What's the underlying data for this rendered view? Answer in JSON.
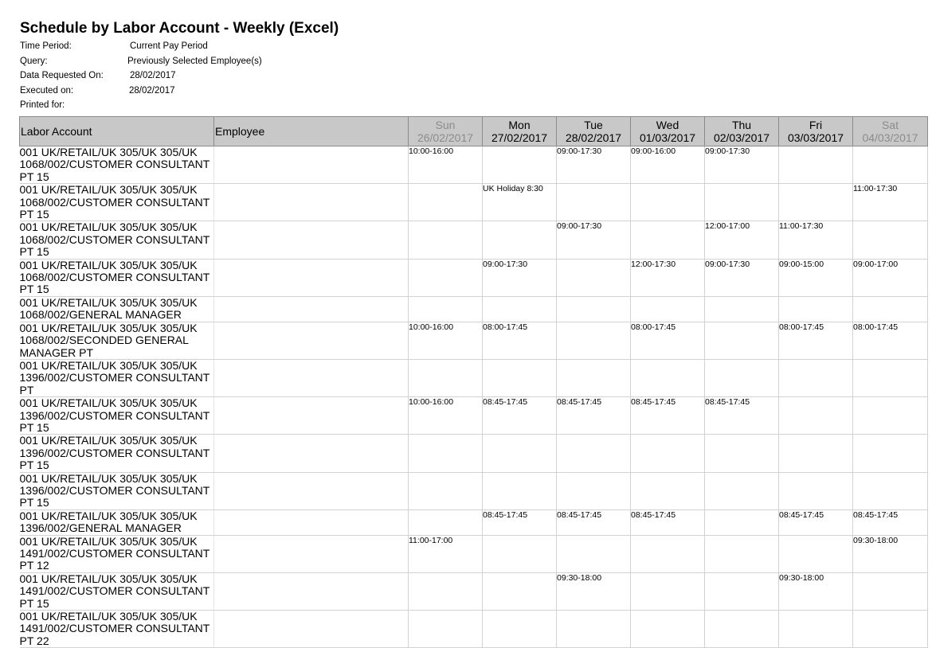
{
  "report": {
    "title": "Schedule by Labor Account - Weekly (Excel)",
    "meta": [
      {
        "label": "Time Period:",
        "value": "Current Pay Period"
      },
      {
        "label": "Query:",
        "value": "Previously Selected Employee(s)"
      },
      {
        "label": "Data Requested On:",
        "value": "28/02/2017"
      },
      {
        "label": "Executed on:",
        "value": "28/02/2017"
      },
      {
        "label": "Printed for:",
        "value": ""
      }
    ]
  },
  "table": {
    "headers": {
      "labor_account": "Labor Account",
      "employee": "Employee"
    },
    "days": [
      {
        "name": "Sun",
        "date": "26/02/2017",
        "weekend": true
      },
      {
        "name": "Mon",
        "date": "27/02/2017",
        "weekend": false
      },
      {
        "name": "Tue",
        "date": "28/02/2017",
        "weekend": false
      },
      {
        "name": "Wed",
        "date": "01/03/2017",
        "weekend": false
      },
      {
        "name": "Thu",
        "date": "02/03/2017",
        "weekend": false
      },
      {
        "name": "Fri",
        "date": "03/03/2017",
        "weekend": false
      },
      {
        "name": "Sat",
        "date": "04/03/2017",
        "weekend": true
      }
    ],
    "rows": [
      {
        "account": "001 UK/RETAIL/UK 305/UK 305/UK 1068/002/CUSTOMER CONSULTANT PT 15",
        "employee": "",
        "shifts": [
          "10:00-16:00",
          "",
          "09:00-17:30",
          "09:00-16:00",
          "09:00-17:30",
          "",
          ""
        ]
      },
      {
        "account": "001 UK/RETAIL/UK 305/UK 305/UK 1068/002/CUSTOMER CONSULTANT PT 15",
        "employee": "",
        "shifts": [
          "",
          "UK Holiday 8:30",
          "",
          "",
          "",
          "",
          "11:00-17:30"
        ]
      },
      {
        "account": "001 UK/RETAIL/UK 305/UK 305/UK 1068/002/CUSTOMER CONSULTANT PT 15",
        "employee": "",
        "shifts": [
          "",
          "",
          "09:00-17:30",
          "",
          "12:00-17:00",
          "11:00-17:30",
          ""
        ]
      },
      {
        "account": "001 UK/RETAIL/UK 305/UK 305/UK 1068/002/CUSTOMER CONSULTANT PT 15",
        "employee": "",
        "shifts": [
          "",
          "09:00-17:30",
          "",
          "12:00-17:30",
          "09:00-17:30",
          "09:00-15:00",
          "09:00-17:00"
        ]
      },
      {
        "account": "001 UK/RETAIL/UK 305/UK 305/UK 1068/002/GENERAL MANAGER",
        "employee": "",
        "shifts": [
          "",
          "",
          "",
          "",
          "",
          "",
          ""
        ]
      },
      {
        "account": "001 UK/RETAIL/UK 305/UK 305/UK 1068/002/SECONDED GENERAL MANAGER PT",
        "employee": "",
        "shifts": [
          "10:00-16:00",
          "08:00-17:45",
          "",
          "08:00-17:45",
          "",
          "08:00-17:45",
          "08:00-17:45"
        ]
      },
      {
        "account": "001 UK/RETAIL/UK 305/UK 305/UK 1396/002/CUSTOMER CONSULTANT PT",
        "employee": "",
        "shifts": [
          "",
          "",
          "",
          "",
          "",
          "",
          ""
        ]
      },
      {
        "account": "001 UK/RETAIL/UK 305/UK 305/UK 1396/002/CUSTOMER CONSULTANT PT 15",
        "employee": "",
        "shifts": [
          "10:00-16:00",
          "08:45-17:45",
          "08:45-17:45",
          "08:45-17:45",
          "08:45-17:45",
          "",
          ""
        ]
      },
      {
        "account": "001 UK/RETAIL/UK 305/UK 305/UK 1396/002/CUSTOMER CONSULTANT PT 15",
        "employee": "",
        "shifts": [
          "",
          "",
          "",
          "",
          "",
          "",
          ""
        ]
      },
      {
        "account": "001 UK/RETAIL/UK 305/UK 305/UK 1396/002/CUSTOMER CONSULTANT PT 15",
        "employee": "",
        "shifts": [
          "",
          "",
          "",
          "",
          "",
          "",
          ""
        ]
      },
      {
        "account": "001 UK/RETAIL/UK 305/UK 305/UK 1396/002/GENERAL MANAGER",
        "employee": "",
        "shifts": [
          "",
          "08:45-17:45",
          "08:45-17:45",
          "08:45-17:45",
          "",
          "08:45-17:45",
          "08:45-17:45"
        ]
      },
      {
        "account": "001 UK/RETAIL/UK 305/UK 305/UK 1491/002/CUSTOMER CONSULTANT PT 12",
        "employee": "",
        "shifts": [
          "11:00-17:00",
          "",
          "",
          "",
          "",
          "",
          "09:30-18:00"
        ]
      },
      {
        "account": "001 UK/RETAIL/UK 305/UK 305/UK 1491/002/CUSTOMER CONSULTANT PT 15",
        "employee": "",
        "shifts": [
          "",
          "",
          "09:30-18:00",
          "",
          "",
          "09:30-18:00",
          ""
        ]
      },
      {
        "account": "001 UK/RETAIL/UK 305/UK 305/UK 1491/002/CUSTOMER CONSULTANT PT 22",
        "employee": "",
        "shifts": [
          "",
          "",
          "",
          "",
          "",
          "",
          ""
        ]
      }
    ]
  }
}
